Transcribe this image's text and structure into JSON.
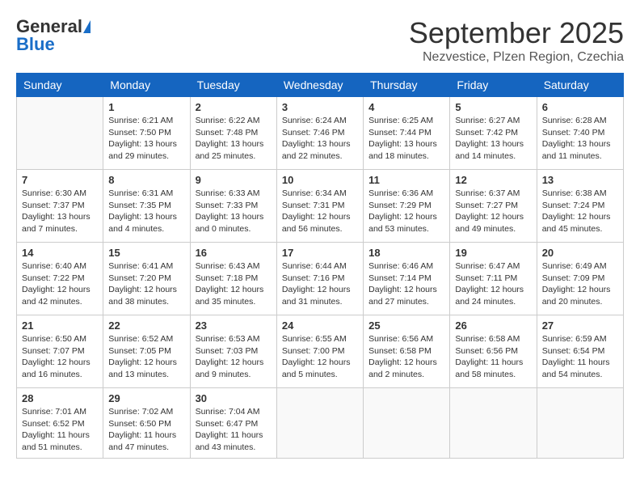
{
  "header": {
    "logo_general": "General",
    "logo_blue": "Blue",
    "month": "September 2025",
    "location": "Nezvestice, Plzen Region, Czechia"
  },
  "weekdays": [
    "Sunday",
    "Monday",
    "Tuesday",
    "Wednesday",
    "Thursday",
    "Friday",
    "Saturday"
  ],
  "weeks": [
    [
      {
        "day": "",
        "info": ""
      },
      {
        "day": "1",
        "info": "Sunrise: 6:21 AM\nSunset: 7:50 PM\nDaylight: 13 hours\nand 29 minutes."
      },
      {
        "day": "2",
        "info": "Sunrise: 6:22 AM\nSunset: 7:48 PM\nDaylight: 13 hours\nand 25 minutes."
      },
      {
        "day": "3",
        "info": "Sunrise: 6:24 AM\nSunset: 7:46 PM\nDaylight: 13 hours\nand 22 minutes."
      },
      {
        "day": "4",
        "info": "Sunrise: 6:25 AM\nSunset: 7:44 PM\nDaylight: 13 hours\nand 18 minutes."
      },
      {
        "day": "5",
        "info": "Sunrise: 6:27 AM\nSunset: 7:42 PM\nDaylight: 13 hours\nand 14 minutes."
      },
      {
        "day": "6",
        "info": "Sunrise: 6:28 AM\nSunset: 7:40 PM\nDaylight: 13 hours\nand 11 minutes."
      }
    ],
    [
      {
        "day": "7",
        "info": "Sunrise: 6:30 AM\nSunset: 7:37 PM\nDaylight: 13 hours\nand 7 minutes."
      },
      {
        "day": "8",
        "info": "Sunrise: 6:31 AM\nSunset: 7:35 PM\nDaylight: 13 hours\nand 4 minutes."
      },
      {
        "day": "9",
        "info": "Sunrise: 6:33 AM\nSunset: 7:33 PM\nDaylight: 13 hours\nand 0 minutes."
      },
      {
        "day": "10",
        "info": "Sunrise: 6:34 AM\nSunset: 7:31 PM\nDaylight: 12 hours\nand 56 minutes."
      },
      {
        "day": "11",
        "info": "Sunrise: 6:36 AM\nSunset: 7:29 PM\nDaylight: 12 hours\nand 53 minutes."
      },
      {
        "day": "12",
        "info": "Sunrise: 6:37 AM\nSunset: 7:27 PM\nDaylight: 12 hours\nand 49 minutes."
      },
      {
        "day": "13",
        "info": "Sunrise: 6:38 AM\nSunset: 7:24 PM\nDaylight: 12 hours\nand 45 minutes."
      }
    ],
    [
      {
        "day": "14",
        "info": "Sunrise: 6:40 AM\nSunset: 7:22 PM\nDaylight: 12 hours\nand 42 minutes."
      },
      {
        "day": "15",
        "info": "Sunrise: 6:41 AM\nSunset: 7:20 PM\nDaylight: 12 hours\nand 38 minutes."
      },
      {
        "day": "16",
        "info": "Sunrise: 6:43 AM\nSunset: 7:18 PM\nDaylight: 12 hours\nand 35 minutes."
      },
      {
        "day": "17",
        "info": "Sunrise: 6:44 AM\nSunset: 7:16 PM\nDaylight: 12 hours\nand 31 minutes."
      },
      {
        "day": "18",
        "info": "Sunrise: 6:46 AM\nSunset: 7:14 PM\nDaylight: 12 hours\nand 27 minutes."
      },
      {
        "day": "19",
        "info": "Sunrise: 6:47 AM\nSunset: 7:11 PM\nDaylight: 12 hours\nand 24 minutes."
      },
      {
        "day": "20",
        "info": "Sunrise: 6:49 AM\nSunset: 7:09 PM\nDaylight: 12 hours\nand 20 minutes."
      }
    ],
    [
      {
        "day": "21",
        "info": "Sunrise: 6:50 AM\nSunset: 7:07 PM\nDaylight: 12 hours\nand 16 minutes."
      },
      {
        "day": "22",
        "info": "Sunrise: 6:52 AM\nSunset: 7:05 PM\nDaylight: 12 hours\nand 13 minutes."
      },
      {
        "day": "23",
        "info": "Sunrise: 6:53 AM\nSunset: 7:03 PM\nDaylight: 12 hours\nand 9 minutes."
      },
      {
        "day": "24",
        "info": "Sunrise: 6:55 AM\nSunset: 7:00 PM\nDaylight: 12 hours\nand 5 minutes."
      },
      {
        "day": "25",
        "info": "Sunrise: 6:56 AM\nSunset: 6:58 PM\nDaylight: 12 hours\nand 2 minutes."
      },
      {
        "day": "26",
        "info": "Sunrise: 6:58 AM\nSunset: 6:56 PM\nDaylight: 11 hours\nand 58 minutes."
      },
      {
        "day": "27",
        "info": "Sunrise: 6:59 AM\nSunset: 6:54 PM\nDaylight: 11 hours\nand 54 minutes."
      }
    ],
    [
      {
        "day": "28",
        "info": "Sunrise: 7:01 AM\nSunset: 6:52 PM\nDaylight: 11 hours\nand 51 minutes."
      },
      {
        "day": "29",
        "info": "Sunrise: 7:02 AM\nSunset: 6:50 PM\nDaylight: 11 hours\nand 47 minutes."
      },
      {
        "day": "30",
        "info": "Sunrise: 7:04 AM\nSunset: 6:47 PM\nDaylight: 11 hours\nand 43 minutes."
      },
      {
        "day": "",
        "info": ""
      },
      {
        "day": "",
        "info": ""
      },
      {
        "day": "",
        "info": ""
      },
      {
        "day": "",
        "info": ""
      }
    ]
  ]
}
